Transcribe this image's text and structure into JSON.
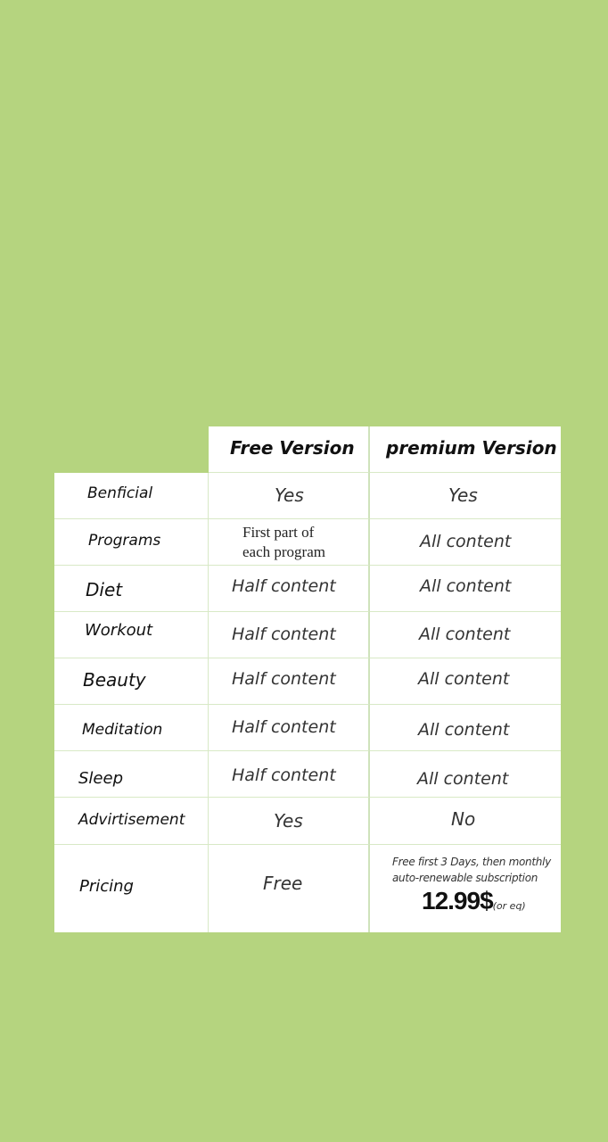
{
  "table": {
    "header": {
      "col_free": "Free Version",
      "col_premium": "premium Version"
    },
    "rows": [
      {
        "label": "Benficial",
        "free": "Yes",
        "premium": "Yes"
      },
      {
        "label": "Programs",
        "free_line1": "First part of",
        "free_line2": "each program",
        "premium": "All content"
      },
      {
        "label": "Diet",
        "free": "Half content",
        "premium": "All content"
      },
      {
        "label": "Workout",
        "free": "Half content",
        "premium": "All content"
      },
      {
        "label": "Beauty",
        "free": "Half content",
        "premium": "All content"
      },
      {
        "label": "Meditation",
        "free": "Half content",
        "premium": "All content"
      },
      {
        "label": "Sleep",
        "free": "Half content",
        "premium": "All content"
      },
      {
        "label": "Advirtisement",
        "free": "Yes",
        "premium": "No"
      },
      {
        "label": "Pricing",
        "free": "Free",
        "premium_note1": "Free first 3 Days, then  monthly",
        "premium_note2": "auto-renewable subscription",
        "premium_price": "12.99$",
        "premium_price_suffix": "(or eq)"
      }
    ]
  }
}
